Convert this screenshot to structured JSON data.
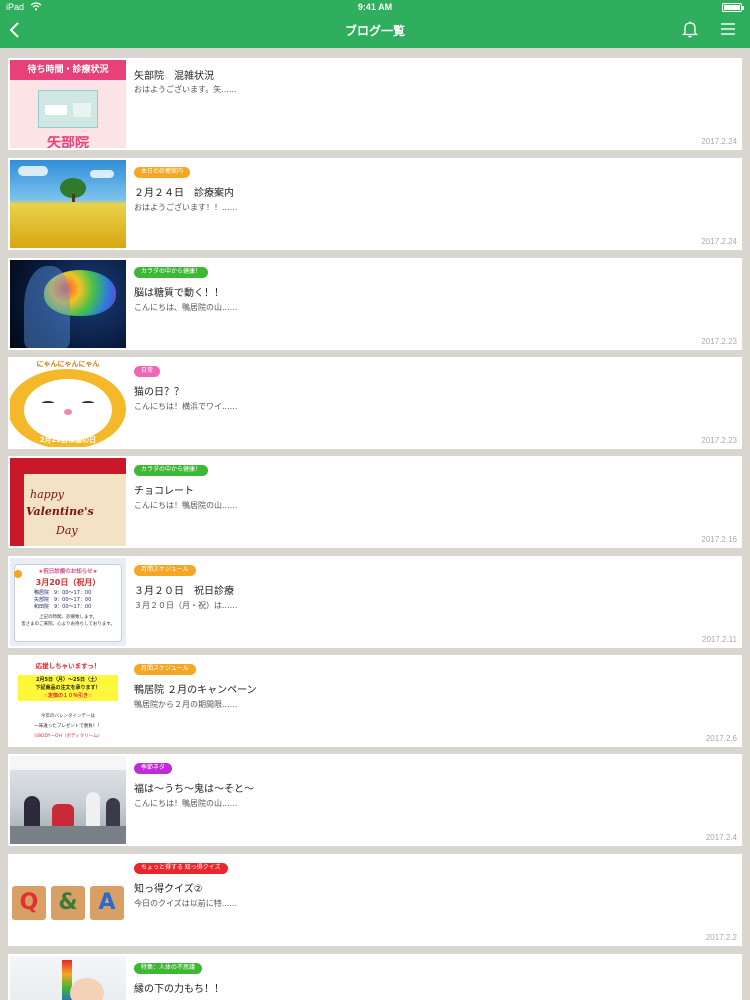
{
  "status_bar": {
    "carrier": "iPad",
    "time": "9:41 AM"
  },
  "header": {
    "title": "ブログ一覧"
  },
  "icons": {
    "back": "chevron-left-icon",
    "bell": "bell-icon",
    "menu": "hamburger-menu-icon"
  },
  "posts": [
    {
      "badge": null,
      "badge_color": null,
      "title": "矢部院　混雑状況",
      "excerpt": "おはようございます。矢......",
      "date": "2017.2.24",
      "thumb_title": "待ち時間・診療状況",
      "thumb_sub": "矢部院"
    },
    {
      "badge": "本日の診療案内",
      "badge_color": "#f5a623",
      "title": "２月２４日　診療案内",
      "excerpt": "おはようございます！！......",
      "date": "2017.2.24"
    },
    {
      "badge": "カラダの中から健康！",
      "badge_color": "#3cb834",
      "title": "脳は糖質で動く！！",
      "excerpt": "こんにちは、鴨居院の山......",
      "date": "2017.2.23"
    },
    {
      "badge": "日常",
      "badge_color": "#ee66b8",
      "title": "猫の日？？",
      "excerpt": "こんにちは！横浜でワイ......",
      "date": "2017.2.23",
      "thumb_title": "にゃんにゃんにゃん",
      "thumb_sub": "2月22日は猫の日"
    },
    {
      "badge": "カラダの中から健康！",
      "badge_color": "#3cb834",
      "title": "チョコレート",
      "excerpt": "こんにちは！鴨居院の山......",
      "date": "2017.2.16",
      "thumb_title": "happy",
      "thumb_sub": "Valentine's",
      "thumb_sub2": "Day"
    },
    {
      "badge": "月間スケジュール",
      "badge_color": "#f5a623",
      "title": "３月２０日　祝日診療",
      "excerpt": "３月２０日（月・祝）は......",
      "date": "2017.2.11",
      "thumb_title": "★祝日診療のお知らせ★",
      "thumb_sub": "3月20日（祝月）",
      "thumb_rows": [
        "鴨居院　9：00〜17：00",
        "矢部院　9：00〜17：00",
        "和田院　9：00〜17：00"
      ],
      "thumb_note": "上記の時間、診療致します。",
      "thumb_note2": "皆さまのご来院、心よりお待ちしております。"
    },
    {
      "badge": "月間スケジュール",
      "badge_color": "#f5a623",
      "title": "鴨居院 ２月のキャンペーン",
      "excerpt": "鴨居院から２月の期間限......",
      "date": "2017.2.6",
      "thumb_title": "応援しちゃいますっ！",
      "thumb_sub": "2月5日（月）〜25日（土）",
      "thumb_rows": [
        "下記商品の注文を承ります！",
        "☆定価の１０％引き☆"
      ],
      "thumb_note": "今年のバレンタインデーは",
      "thumb_note2": "一味違ったプレゼントで勝負！！",
      "thumb_note3": "①BODYーOH（ボディクリーム）"
    },
    {
      "badge": "季節ネタ",
      "badge_color": "#c02bd8",
      "title": "福は〜うち〜鬼は〜そと〜",
      "excerpt": "こんにちは！鴨居院の山......",
      "date": "2017.2.4"
    },
    {
      "badge": "ちょっと得する 知っ得クイズ",
      "badge_color": "#e8262c",
      "title": "知っ得クイズ②",
      "excerpt": "今日のクイズは以前に特......",
      "date": "2017.2.2",
      "thumb_letters": [
        "Q",
        "&",
        "A"
      ]
    },
    {
      "badge": "特集：人体の不思議",
      "badge_color": "#3cb834",
      "title": "縁の下の力もち！！",
      "excerpt": "",
      "date": ""
    }
  ]
}
